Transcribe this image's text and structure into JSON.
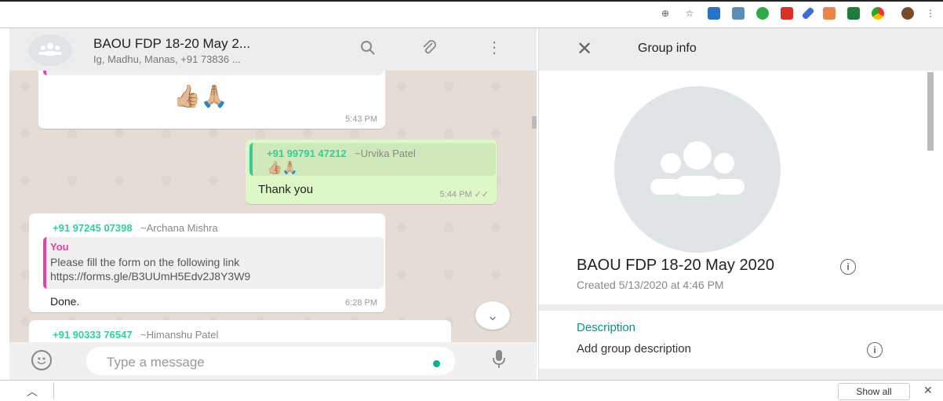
{
  "chat": {
    "title": "BAOU FDP 18-20 May 2...",
    "subtitle": "Ig, Madhu, Manas, +91 73836 ...",
    "messages": [
      {
        "emojis": "👍🏼🙏🏼",
        "time": "5:43 PM"
      },
      {
        "quote_sender": "+91 99791 47212",
        "quote_name": "~Urvika Patel",
        "quote_emojis": "👍🏼🙏🏼",
        "text": "Thank you",
        "time": "5:44 PM ✓✓"
      },
      {
        "sender": "+91 97245 07398",
        "name": "~Archana Mishra",
        "quote_sender": "You",
        "quote_text": "Please fill the form on the following link",
        "quote_link": "https://forms.gle/B3UUmH5Edv2J8Y3W9",
        "text": "Done.",
        "time": "6:28 PM"
      },
      {
        "sender": "+91 90333 76547",
        "name": "~Himanshu Patel"
      }
    ],
    "input_placeholder": "Type a message"
  },
  "group_info": {
    "title": "Group info",
    "name": "BAOU FDP 18-20 May 2020",
    "created": "Created 5/13/2020 at 4:46 PM",
    "description_label": "Description",
    "description_value": "Add group description"
  },
  "downloads": {
    "show_all": "Show all"
  },
  "icons": [
    "zoom-icon",
    "star-icon",
    "search-icon",
    "attach-icon",
    "menu-icon",
    "close-icon",
    "emoji-icon",
    "mic-icon",
    "info-icon",
    "chevron-down-icon"
  ],
  "colors": {
    "accent": "#009688",
    "outgoing": "#dcf8c6",
    "sender": "#35cd96",
    "quote_bar": "#e542a3"
  }
}
